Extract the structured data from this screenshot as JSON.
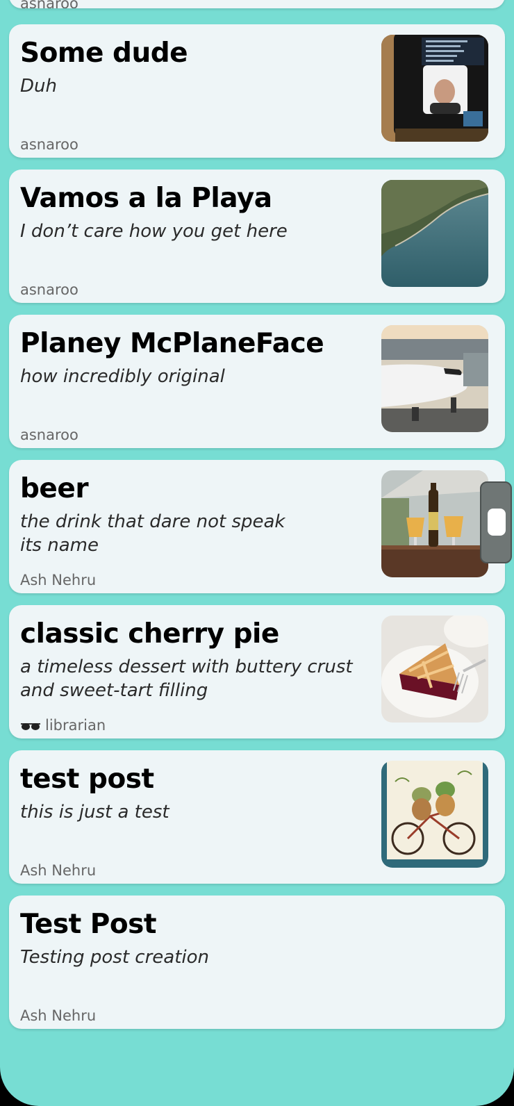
{
  "colors": {
    "background": "#77ddd3",
    "card": "#eef5f7",
    "author_text": "#666666"
  },
  "partial_top_card": {
    "author": "asnaroo"
  },
  "posts": [
    {
      "title": "Some dude",
      "subtitle": "Duh",
      "author": "asnaroo",
      "thumbnail": "person-on-laptop-screen-photo"
    },
    {
      "title": "Vamos a la Playa",
      "subtitle": "I don’t care how you get here",
      "author": "asnaroo",
      "thumbnail": "aerial-coastline-photo"
    },
    {
      "title": "Planey McPlaneFace",
      "subtitle": "how incredibly original",
      "author": "asnaroo",
      "thumbnail": "airplane-at-gate-photo"
    },
    {
      "title": "beer",
      "subtitle": "the drink that dare not speak its name",
      "author": "Ash Nehru",
      "thumbnail": "beer-glasses-photo"
    },
    {
      "title": "classic cherry pie",
      "subtitle": "a timeless dessert with buttery crust and sweet-tart filling",
      "author": "librarian",
      "author_icon": "glasses-icon",
      "thumbnail": "cherry-pie-slice-photo"
    },
    {
      "title": "test post",
      "subtitle": "this is just a test",
      "author": "Ash Nehru",
      "thumbnail": "frogs-on-bicycle-illustration"
    },
    {
      "title": "Test Post",
      "subtitle": "Testing post creation",
      "author": "Ash Nehru"
    }
  ]
}
